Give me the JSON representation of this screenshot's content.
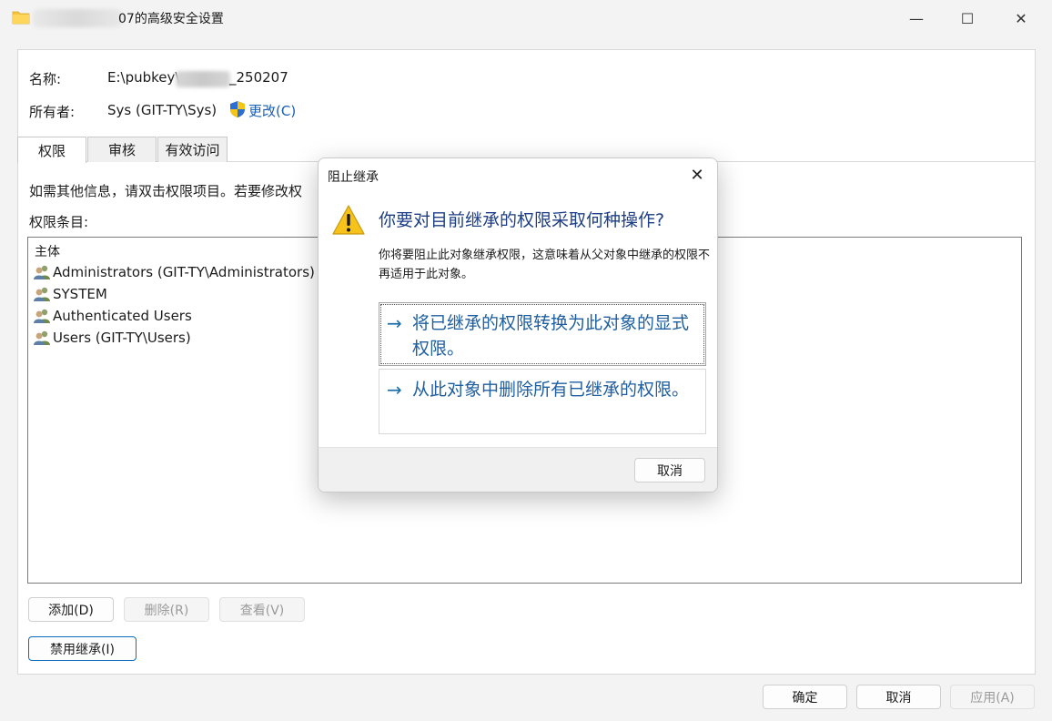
{
  "window": {
    "title_suffix": "07的高级安全设置",
    "controls": {
      "minimize": "—",
      "maximize": "☐",
      "close": "✕"
    }
  },
  "fields": {
    "name_label": "名称:",
    "name_prefix": "E:\\pubkey\\",
    "name_suffix": "_250207",
    "owner_label": "所有者:",
    "owner_value": "Sys (GIT-TY\\Sys)",
    "change_link": "更改(C)"
  },
  "tabs": [
    "权限",
    "审核",
    "有效访问"
  ],
  "info_text": "如需其他信息，请双击权限项目。若要修改权",
  "entries_label": "权限条目:",
  "list": {
    "header": "主体",
    "items": [
      "Administrators (GIT-TY\\Administrators)",
      "SYSTEM",
      "Authenticated Users",
      "Users (GIT-TY\\Users)"
    ]
  },
  "buttons": {
    "add": "添加(D)",
    "remove": "删除(R)",
    "view": "查看(V)",
    "disable_inheritance": "禁用继承(I)",
    "ok": "确定",
    "cancel": "取消",
    "apply": "应用(A)"
  },
  "dialog": {
    "title": "阻止继承",
    "heading": "你要对目前继承的权限采取何种操作?",
    "description": "你将要阻止此对象继承权限，这意味着从父对象中继承的权限不再适用于此对象。",
    "option1": "将已继承的权限转换为此对象的显式权限。",
    "option2": "从此对象中删除所有已继承的权限。",
    "arrow": "→",
    "cancel": "取消"
  },
  "icons": {
    "folder": "folder-icon",
    "shield": "uac-shield-icon",
    "users": "users-icon",
    "warning": "warning-icon"
  },
  "colors": {
    "link": "#1a5fb4",
    "dialog_heading": "#1e3f86",
    "command_link": "#1f5fa0",
    "focus": "#0f6cbd"
  }
}
